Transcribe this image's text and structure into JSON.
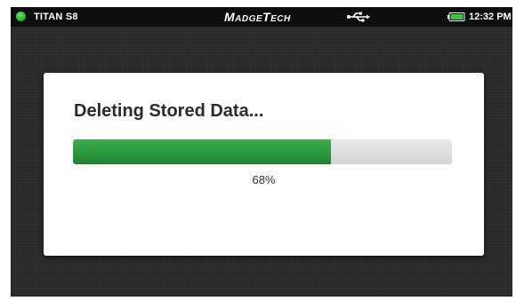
{
  "status_bar": {
    "device_name": "TITAN S8",
    "brand": "MadgeTech",
    "time": "12:32 PM",
    "indicator_color": "#2fb82f",
    "usb_icon": "usb-icon",
    "battery_icon": "battery-icon",
    "battery_level": 1.0
  },
  "dialog": {
    "title": "Deleting Stored Data...",
    "progress_percent": 68,
    "progress_label": "68%",
    "progress_color": "#2c9a3e"
  }
}
